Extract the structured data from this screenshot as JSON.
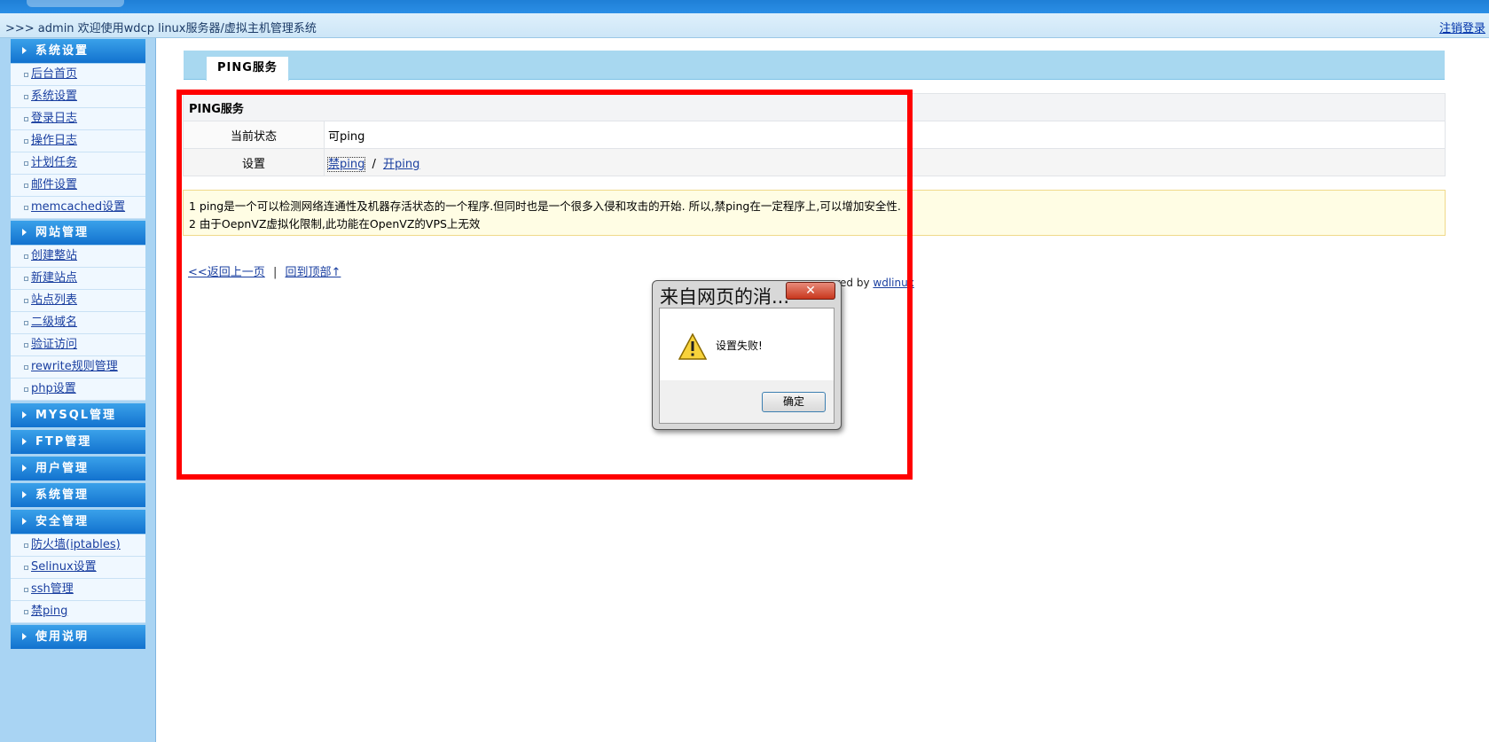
{
  "header": {
    "welcome": ">>> admin 欢迎使用wdcp linux服务器/虚拟主机管理系统",
    "logout": "注销登录"
  },
  "sidebar": {
    "groups": [
      {
        "title": "系统设置",
        "items": [
          "后台首页",
          "系统设置",
          "登录日志",
          "操作日志",
          "计划任务",
          "邮件设置",
          "memcached设置"
        ]
      },
      {
        "title": "网站管理",
        "items": [
          "创建整站",
          "新建站点",
          "站点列表",
          "二级域名",
          "验证访问",
          "rewrite规则管理",
          "php设置"
        ]
      },
      {
        "title": "MYSQL管理"
      },
      {
        "title": "FTP管理"
      },
      {
        "title": "用户管理"
      },
      {
        "title": "系统管理"
      },
      {
        "title": "安全管理",
        "items": [
          "防火墙(iptables)",
          "Selinux设置",
          "ssh管理",
          "禁ping"
        ]
      },
      {
        "title": "使用说明"
      }
    ]
  },
  "main": {
    "tab_label": "PING服务",
    "table": {
      "title": "PING服务",
      "status_label": "当前状态",
      "status_value": "可ping",
      "setting_label": "设置",
      "disable_link": "禁ping",
      "divider": "/",
      "enable_link": "开ping"
    },
    "notice": [
      "1 ping是一个可以检测网络连通性及机器存活状态的一个程序.但同时也是一个很多入侵和攻击的开始. 所以,禁ping在一定程序上,可以增加安全性.",
      "2 由于OepnVZ虚拟化限制,此功能在OpenVZ的VPS上无效"
    ],
    "back_link": "<<返回上一页",
    "separator": "|",
    "top_link": "回到顶部↑",
    "powered_prefix": "ered by ",
    "powered_link": "wdlinux"
  },
  "dialog": {
    "title": "来自网页的消...",
    "close_glyph": "✕",
    "message": "设置失败!",
    "ok_label": "确定"
  },
  "colors": {
    "highlight": "#ff0000",
    "sidebar_bg": "#a9d4f3",
    "group_head": "#1272cf"
  }
}
